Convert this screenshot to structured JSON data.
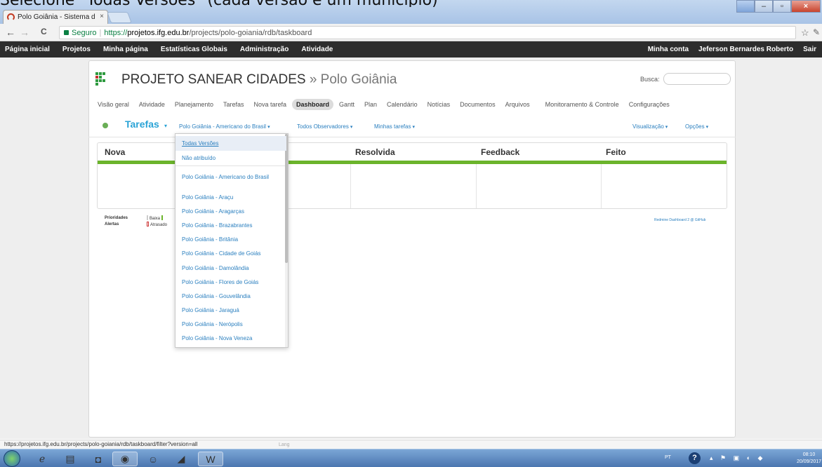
{
  "caption": "Selecione \"Todas Versões\" (cada versão é um município)",
  "browser": {
    "tab_title": "Polo Goiânia - Sistema d",
    "tab_close": "×",
    "secure_label": "Seguro",
    "url_scheme": "https://",
    "url_host": "projetos.ifg.edu.br",
    "url_path": "/projects/polo-goiania/rdb/taskboard",
    "back": "←",
    "forward": "→",
    "reload": "C",
    "star": "☆",
    "extension": "✎"
  },
  "topmenu": {
    "left": [
      "Página inicial",
      "Projetos",
      "Minha página",
      "Estatísticas Globais",
      "Administração",
      "Atividade"
    ],
    "right": [
      "Minha conta",
      "Jeferson Bernardes Roberto",
      "Sair"
    ]
  },
  "project": {
    "title": "PROJETO SANEAR CIDADES",
    "separator": " » ",
    "subtitle": "Polo Goiânia",
    "search_label": "Busca:"
  },
  "project_menu": [
    "Visão geral",
    "Atividade",
    "Planejamento",
    "Tarefas",
    "Nova tarefa",
    "Dashboard",
    "Gantt",
    "Plan",
    "Calendário",
    "Notícias",
    "Documentos",
    "Arquivos",
    "Monitoramento & Controle",
    "Configurações"
  ],
  "dashboard": {
    "title": "Tarefas",
    "version_filter": "Polo Goiânia - Americano do Brasil",
    "observer_filter": "Todos Observadores",
    "my_tasks": "Minhas tarefas",
    "view": "Visualização",
    "options": "Opções",
    "caret": "▾"
  },
  "board": {
    "columns": [
      "Nova",
      "Resolvida",
      "Feedback",
      "Feito"
    ]
  },
  "legend": {
    "priorities_label": "Prioridades",
    "priority_low": "Baixa",
    "alerts_label": "Alertas",
    "alert_late": "Atrasado",
    "credit": "Redmine Dashboard 2 @ GitHub"
  },
  "dropdown": {
    "items": [
      "Todas Versões",
      "Não atribuído",
      "Polo Goiânia - Americano do Brasil",
      "Polo Goiânia - Araçu",
      "Polo Goiânia - Aragarças",
      "Polo Goiânia - Brazabrantes",
      "Polo Goiânia - Britânia",
      "Polo Goiânia - Cidade de Goiás",
      "Polo Goiânia - Damolândia",
      "Polo Goiânia - Flores de Goiás",
      "Polo Goiânia - Gouvelândia",
      "Polo Goiânia - Jaraguá",
      "Polo Goiânia - Nerópolis",
      "Polo Goiânia - Nova Veneza"
    ]
  },
  "status": {
    "url": "https://projetos.ifg.edu.br/projects/polo-goiania/rdb/taskboard/filter?version=all",
    "lang": "Lang"
  },
  "taskbar": {
    "tray_lang": "PT",
    "help": "?",
    "tray_icons": "▴ ⚑ ▣ ◐ ◆",
    "time": "08:10",
    "date": "20/09/2017"
  }
}
